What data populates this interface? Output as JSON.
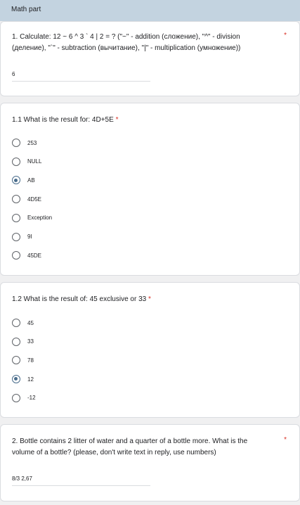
{
  "section": {
    "title": "Math part"
  },
  "q1": {
    "line1": "1. Calculate: 12 ~ 6 ^ 3 ` 4 | 2  = ? (\"~\" - addition (сложение), \"^\" - division",
    "line2": "(деление), \"`\" - subtraction (вычитание),  \"|\" - multiplication (умножение))",
    "required": "*",
    "answer": "6"
  },
  "q11": {
    "title": "1.1 What is the result for: 4D+5E",
    "required": "*",
    "options": [
      "253",
      "NULL",
      "AB",
      "4D5E",
      "Exception",
      "9I",
      "45DE"
    ],
    "selected": "AB"
  },
  "q12": {
    "title": "1.2 What is the result of: 45 exclusive or 33",
    "required": "*",
    "options": [
      "45",
      "33",
      "78",
      "12",
      "-12"
    ],
    "selected": "12"
  },
  "q2": {
    "line1": "2. Bottle contains 2 litter of water and a quarter of a bottle more. What is the",
    "line2": "volume of a bottle? (please, don't write text in reply, use numbers)",
    "required": "*",
    "answer": "8/3 2,67"
  }
}
